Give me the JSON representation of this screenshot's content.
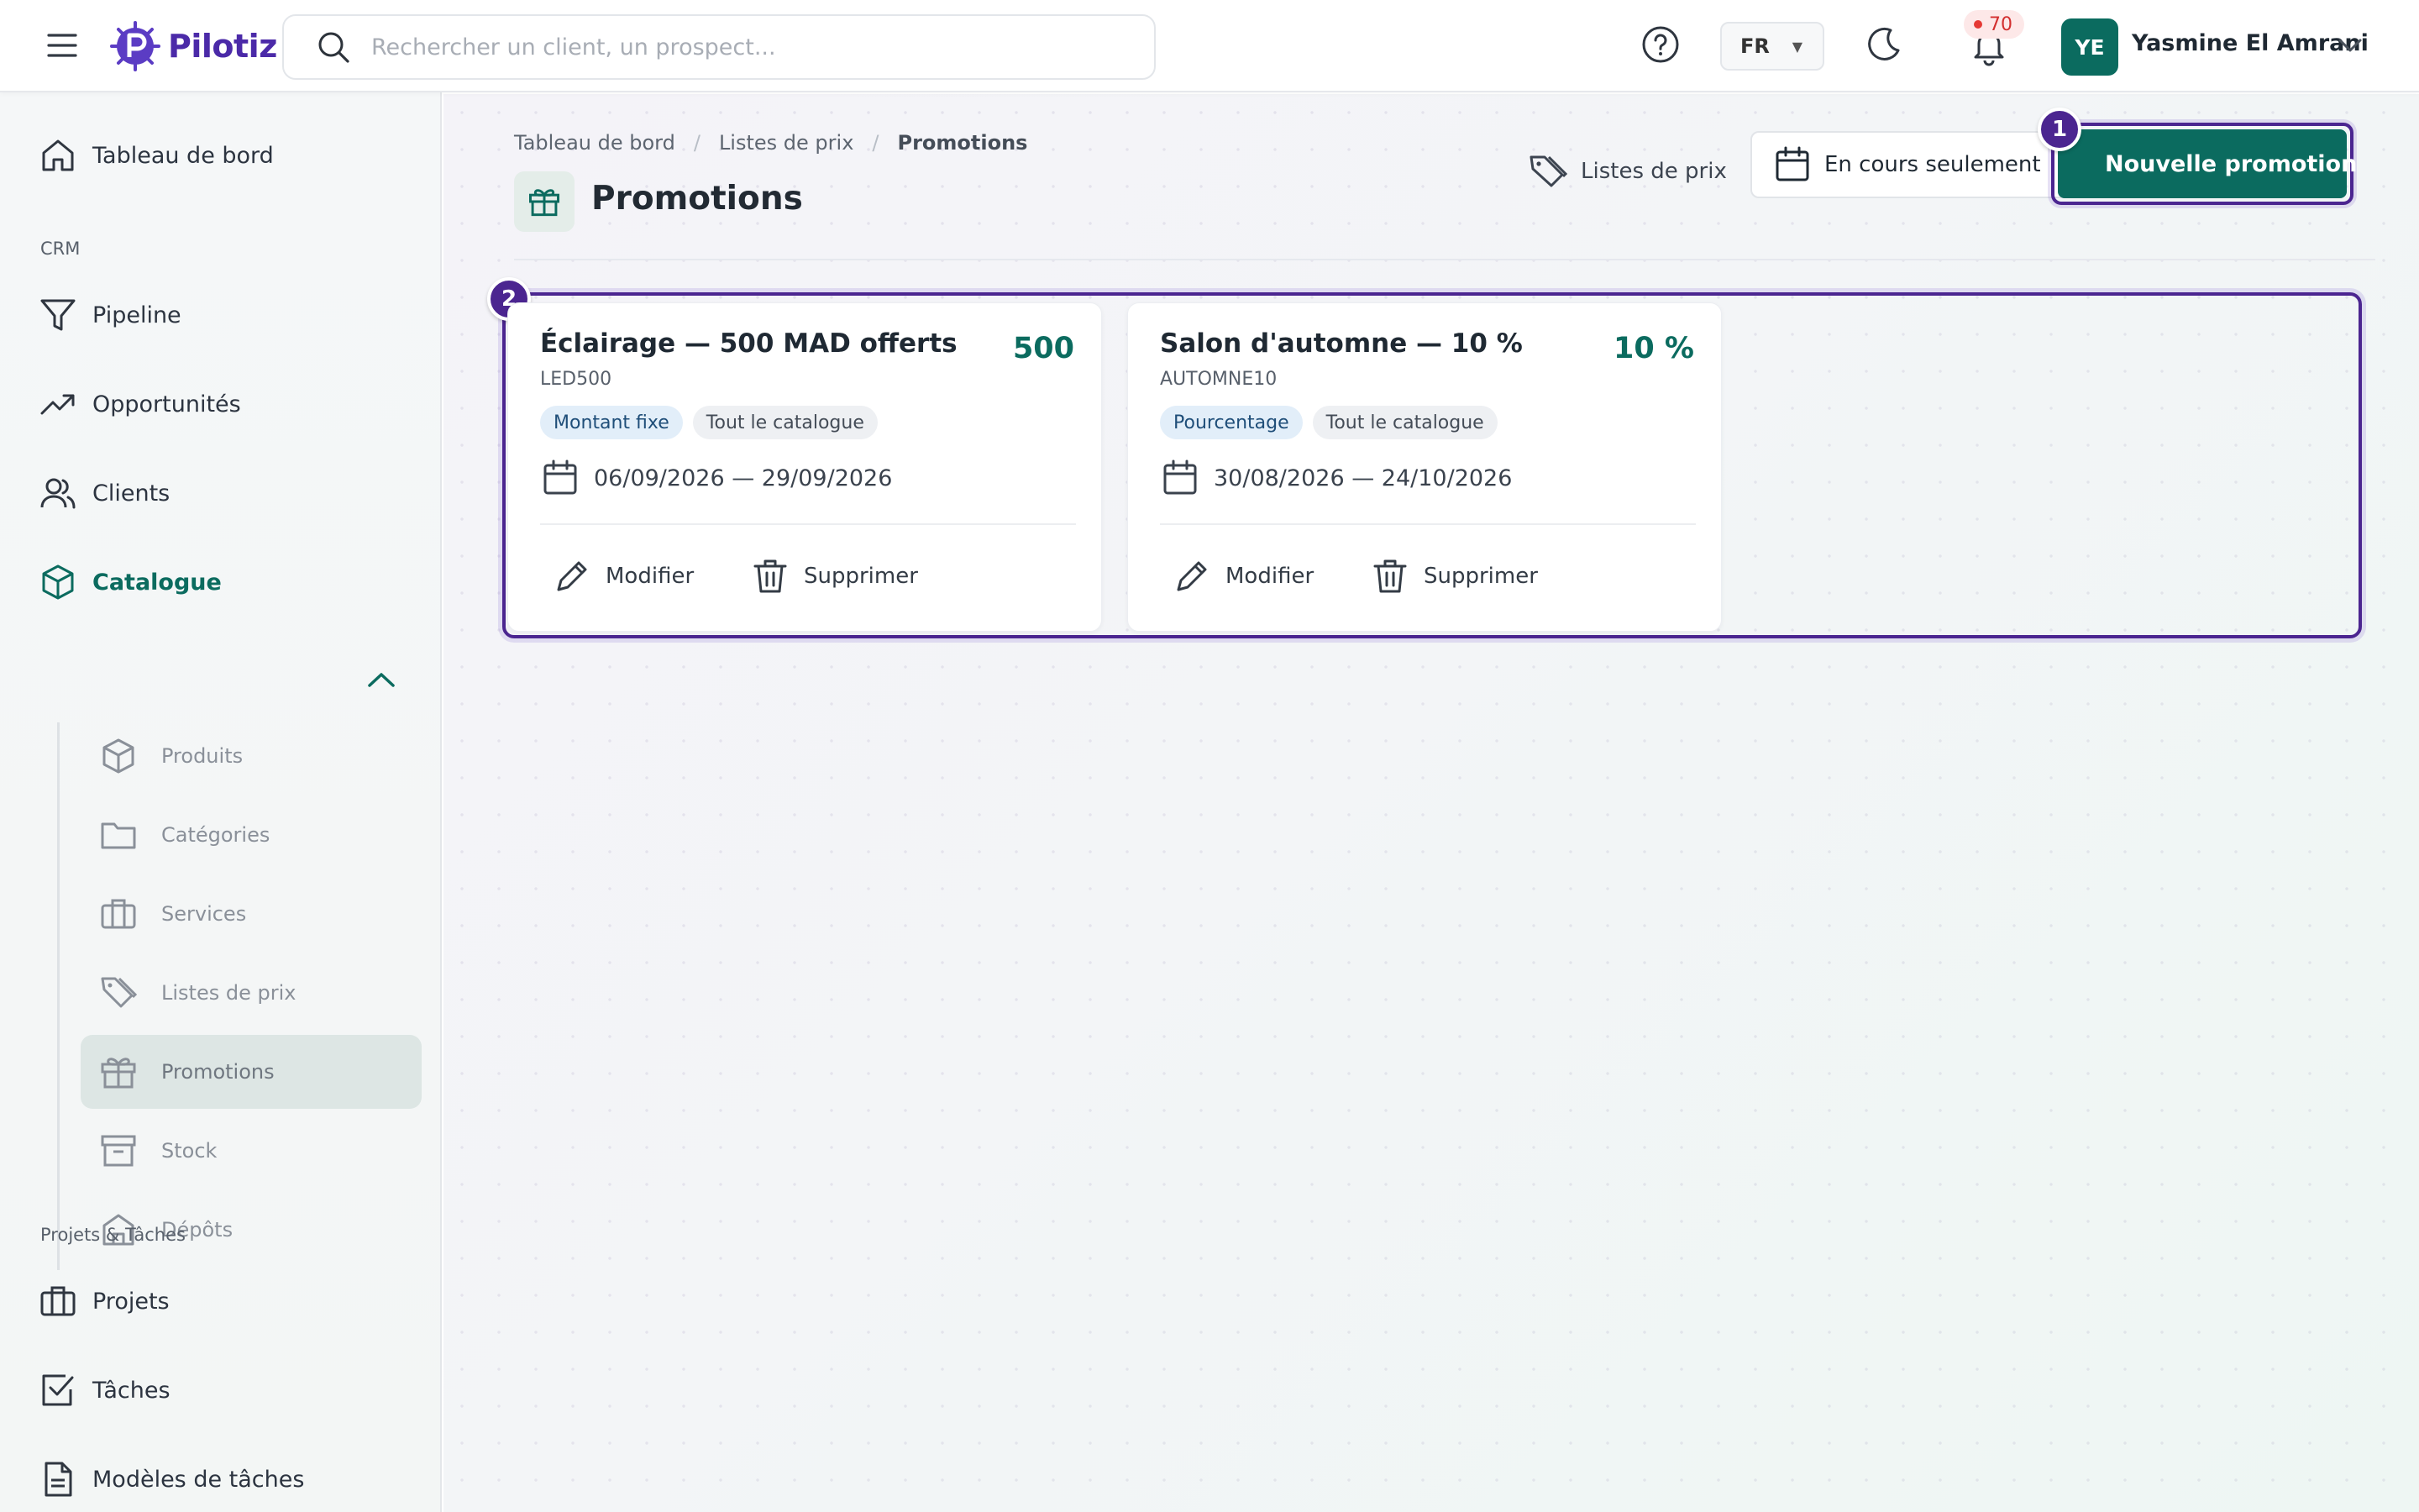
{
  "header": {
    "logo_text": "Pilotiz",
    "search_placeholder": "Rechercher un client, un prospect...",
    "language": "FR",
    "notifications_count": "70",
    "user_initials": "YE",
    "user_name": "Yasmine El Amrani"
  },
  "sidebar": {
    "dashboard": "Tableau de bord",
    "section_crm": "CRM",
    "pipeline": "Pipeline",
    "opportunities": "Opportunités",
    "clients": "Clients",
    "catalogue": "Catalogue",
    "catalogue_items": [
      {
        "label": "Produits",
        "icon": "cube-icon"
      },
      {
        "label": "Catégories",
        "icon": "folder-icon"
      },
      {
        "label": "Services",
        "icon": "briefcase-icon"
      },
      {
        "label": "Listes de prix",
        "icon": "tags-icon"
      },
      {
        "label": "Promotions",
        "icon": "gift-icon"
      },
      {
        "label": "Stock",
        "icon": "archive-icon"
      },
      {
        "label": "Dépôts",
        "icon": "warehouse-icon"
      }
    ],
    "section_projects": "Projets & Tâches",
    "projects": "Projets",
    "tasks": "Tâches",
    "task_templates": "Modèles de tâches"
  },
  "main": {
    "breadcrumb": [
      "Tableau de bord",
      "Listes de prix",
      "Promotions"
    ],
    "title": "Promotions",
    "btn_pricelists": "Listes de prix",
    "btn_current_only": "En cours seulement",
    "btn_new": "Nouvelle promotion",
    "markers": [
      "1",
      "2"
    ]
  },
  "promotions": [
    {
      "title": "Éclairage — 500 MAD offerts",
      "code": "LED500",
      "value": "500",
      "type": "Montant fixe",
      "scope": "Tout le catalogue",
      "dates": "06/09/2026 — 29/09/2026",
      "edit": "Modifier",
      "delete": "Supprimer"
    },
    {
      "title": "Salon d'automne — 10 %",
      "code": "AUTOMNE10",
      "value": "10 %",
      "type": "Pourcentage",
      "scope": "Tout le catalogue",
      "dates": "30/08/2026 — 24/10/2026",
      "edit": "Modifier",
      "delete": "Supprimer"
    }
  ],
  "colors": {
    "accent": "#0b6b5f",
    "brand": "#4b2aa8",
    "highlight": "#4b2590"
  }
}
